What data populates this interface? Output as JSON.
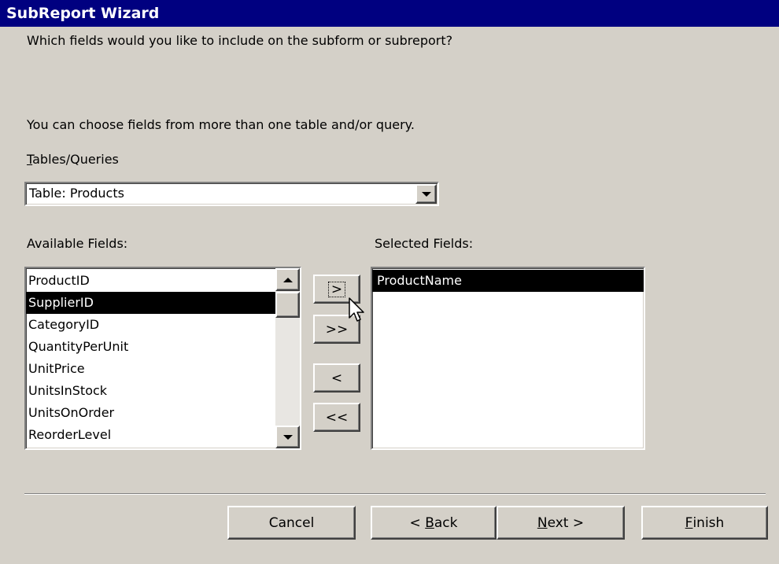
{
  "window": {
    "title": "SubReport Wizard"
  },
  "intro": {
    "question": "Which fields would you like to include on the subform or subreport?",
    "hint": "You can choose fields from more than one table and/or query."
  },
  "tables_queries": {
    "label_underlined": "T",
    "label_rest": "ables/Queries",
    "selected": "Table: Products"
  },
  "available": {
    "label": "Available Fields:",
    "items": [
      "ProductID",
      "SupplierID",
      "CategoryID",
      "QuantityPerUnit",
      "UnitPrice",
      "UnitsInStock",
      "UnitsOnOrder",
      "ReorderLevel"
    ],
    "selected_item": "SupplierID"
  },
  "selected": {
    "label": "Selected Fields:",
    "items": [
      "ProductName"
    ]
  },
  "move_buttons": {
    "add_one": ">",
    "add_all": ">>",
    "remove_one": "<",
    "remove_all": "<<"
  },
  "footer": {
    "cancel": "Cancel",
    "back_prefix": "< ",
    "back_underlined": "B",
    "back_rest": "ack",
    "next_underlined": "N",
    "next_rest": "ext >",
    "finish_underlined": "F",
    "finish_rest": "inish"
  },
  "icons": {
    "dropdown": "chevron-down-icon",
    "cursor": "mouse-pointer-icon"
  },
  "colors": {
    "titlebar": "#000080",
    "face": "#d4d0c8",
    "selection": "#000000"
  }
}
